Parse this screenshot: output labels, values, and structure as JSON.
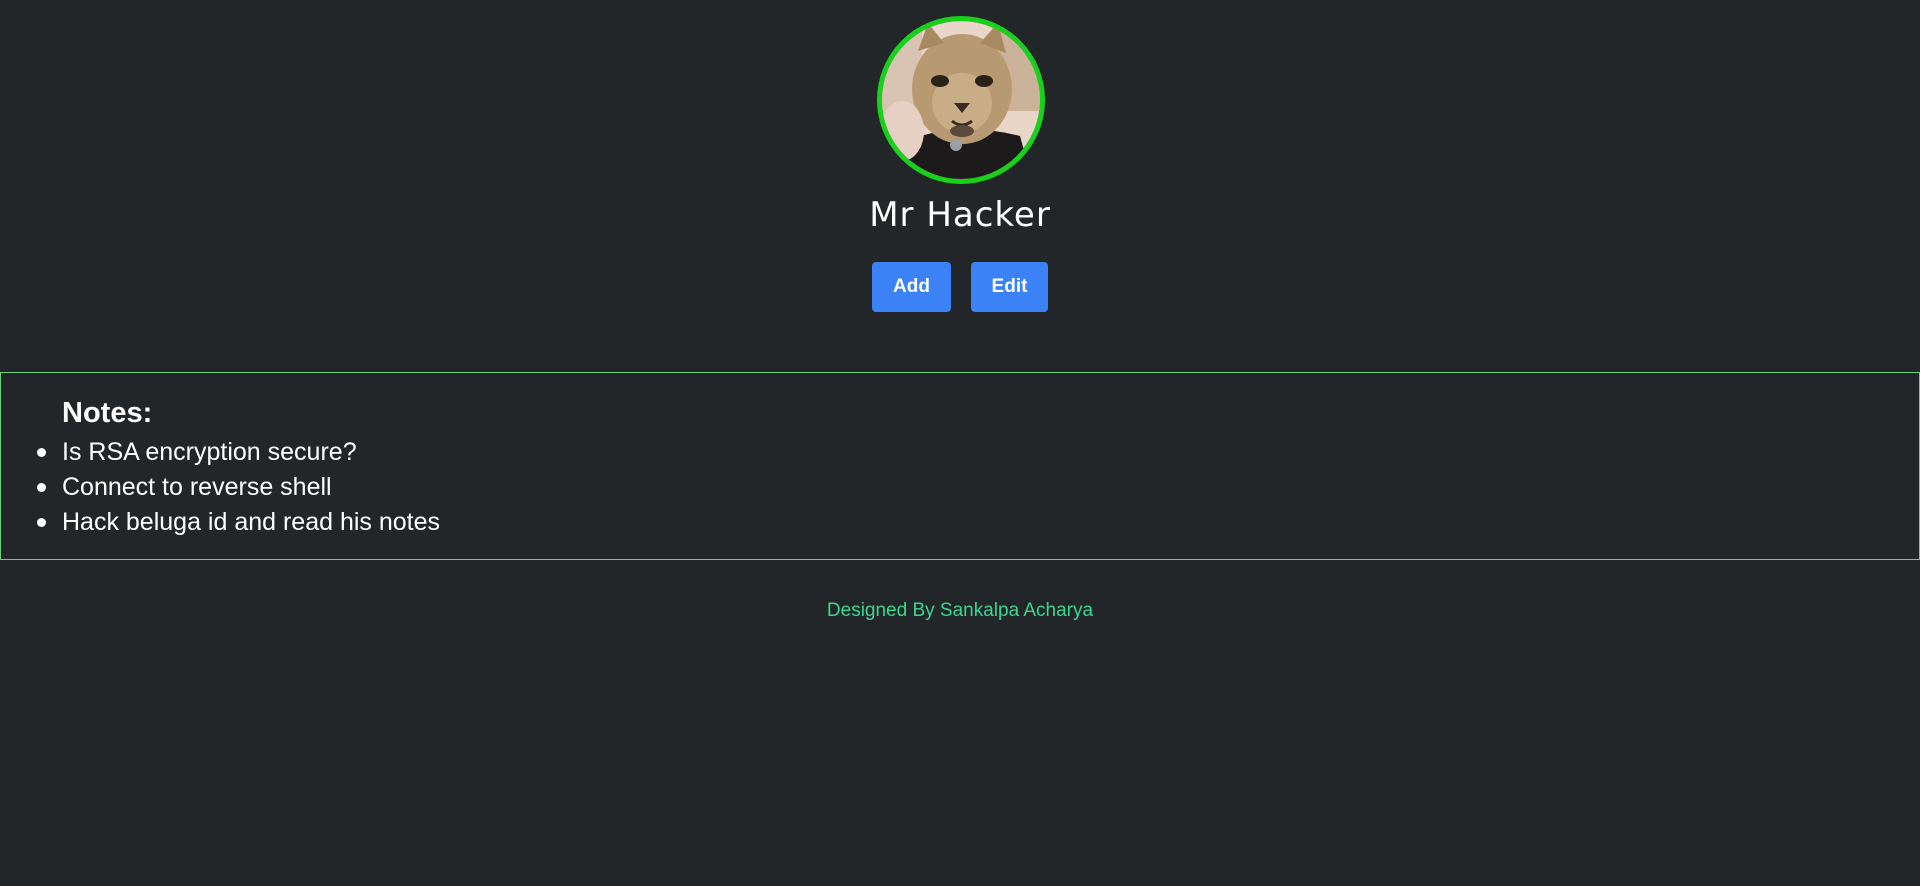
{
  "profile": {
    "name": "Mr Hacker",
    "avatar_icon": "cat-avatar",
    "avatar_border_color": "#17d11a"
  },
  "actions": {
    "add_label": "Add",
    "edit_label": "Edit",
    "button_color": "#3b82f6"
  },
  "notes": {
    "title": "Notes:",
    "items": [
      "Is RSA encryption secure?",
      "Connect to reverse shell",
      "Hack beluga id and read his notes"
    ],
    "border_color": "#6fcf7f"
  },
  "footer": {
    "text": "Designed By Sankalpa Acharya",
    "color": "#3dd68c"
  },
  "theme": {
    "background": "#222629"
  }
}
